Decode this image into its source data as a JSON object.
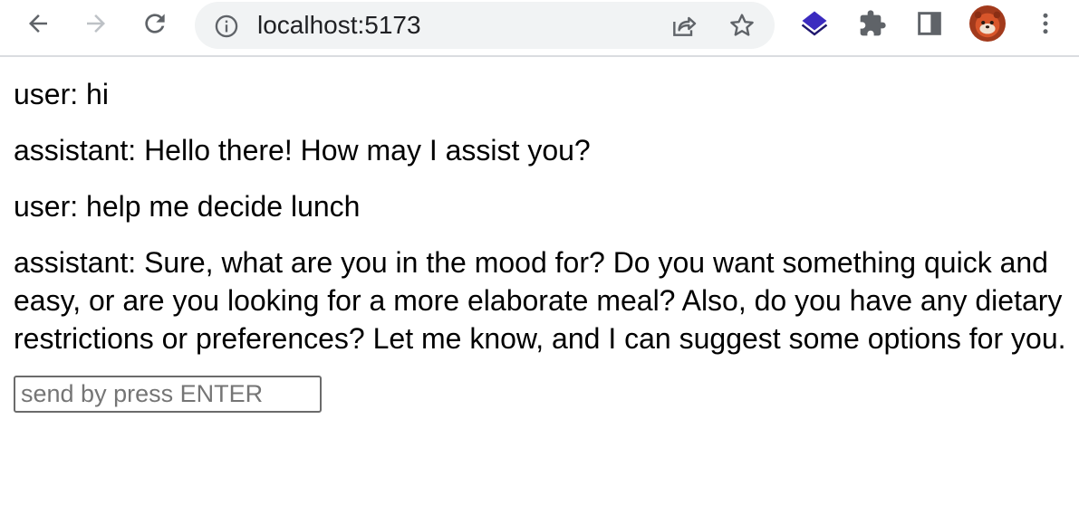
{
  "browser": {
    "url": "localhost:5173",
    "icons": {
      "back": "back-arrow-icon",
      "forward": "forward-arrow-icon",
      "reload": "reload-icon",
      "site_info": "info-icon",
      "share": "share-icon",
      "bookmark": "star-icon",
      "extension_1": "layers-extension-icon",
      "extensions": "puzzle-icon",
      "side_panel": "side-panel-icon",
      "profile": "profile-avatar",
      "menu": "kebab-menu-icon"
    },
    "colors": {
      "toolbar_bg": "#ffffff",
      "omnibox_bg": "#f1f3f4",
      "icon": "#5f6368",
      "icon_disabled": "#bdc1c6",
      "extension_accent": "#3b2bbf"
    }
  },
  "chat": {
    "messages": [
      {
        "text": "user: hi"
      },
      {
        "text": "assistant: Hello there! How may I assist you?"
      },
      {
        "text": "user: help me decide lunch"
      },
      {
        "text": "assistant: Sure, what are you in the mood for? Do you want something quick and easy, or are you looking for a more elaborate meal? Also, do you have any dietary restrictions or preferences? Let me know, and I can suggest some options for you."
      }
    ],
    "input": {
      "value": "",
      "placeholder": "send by press ENTER"
    }
  }
}
